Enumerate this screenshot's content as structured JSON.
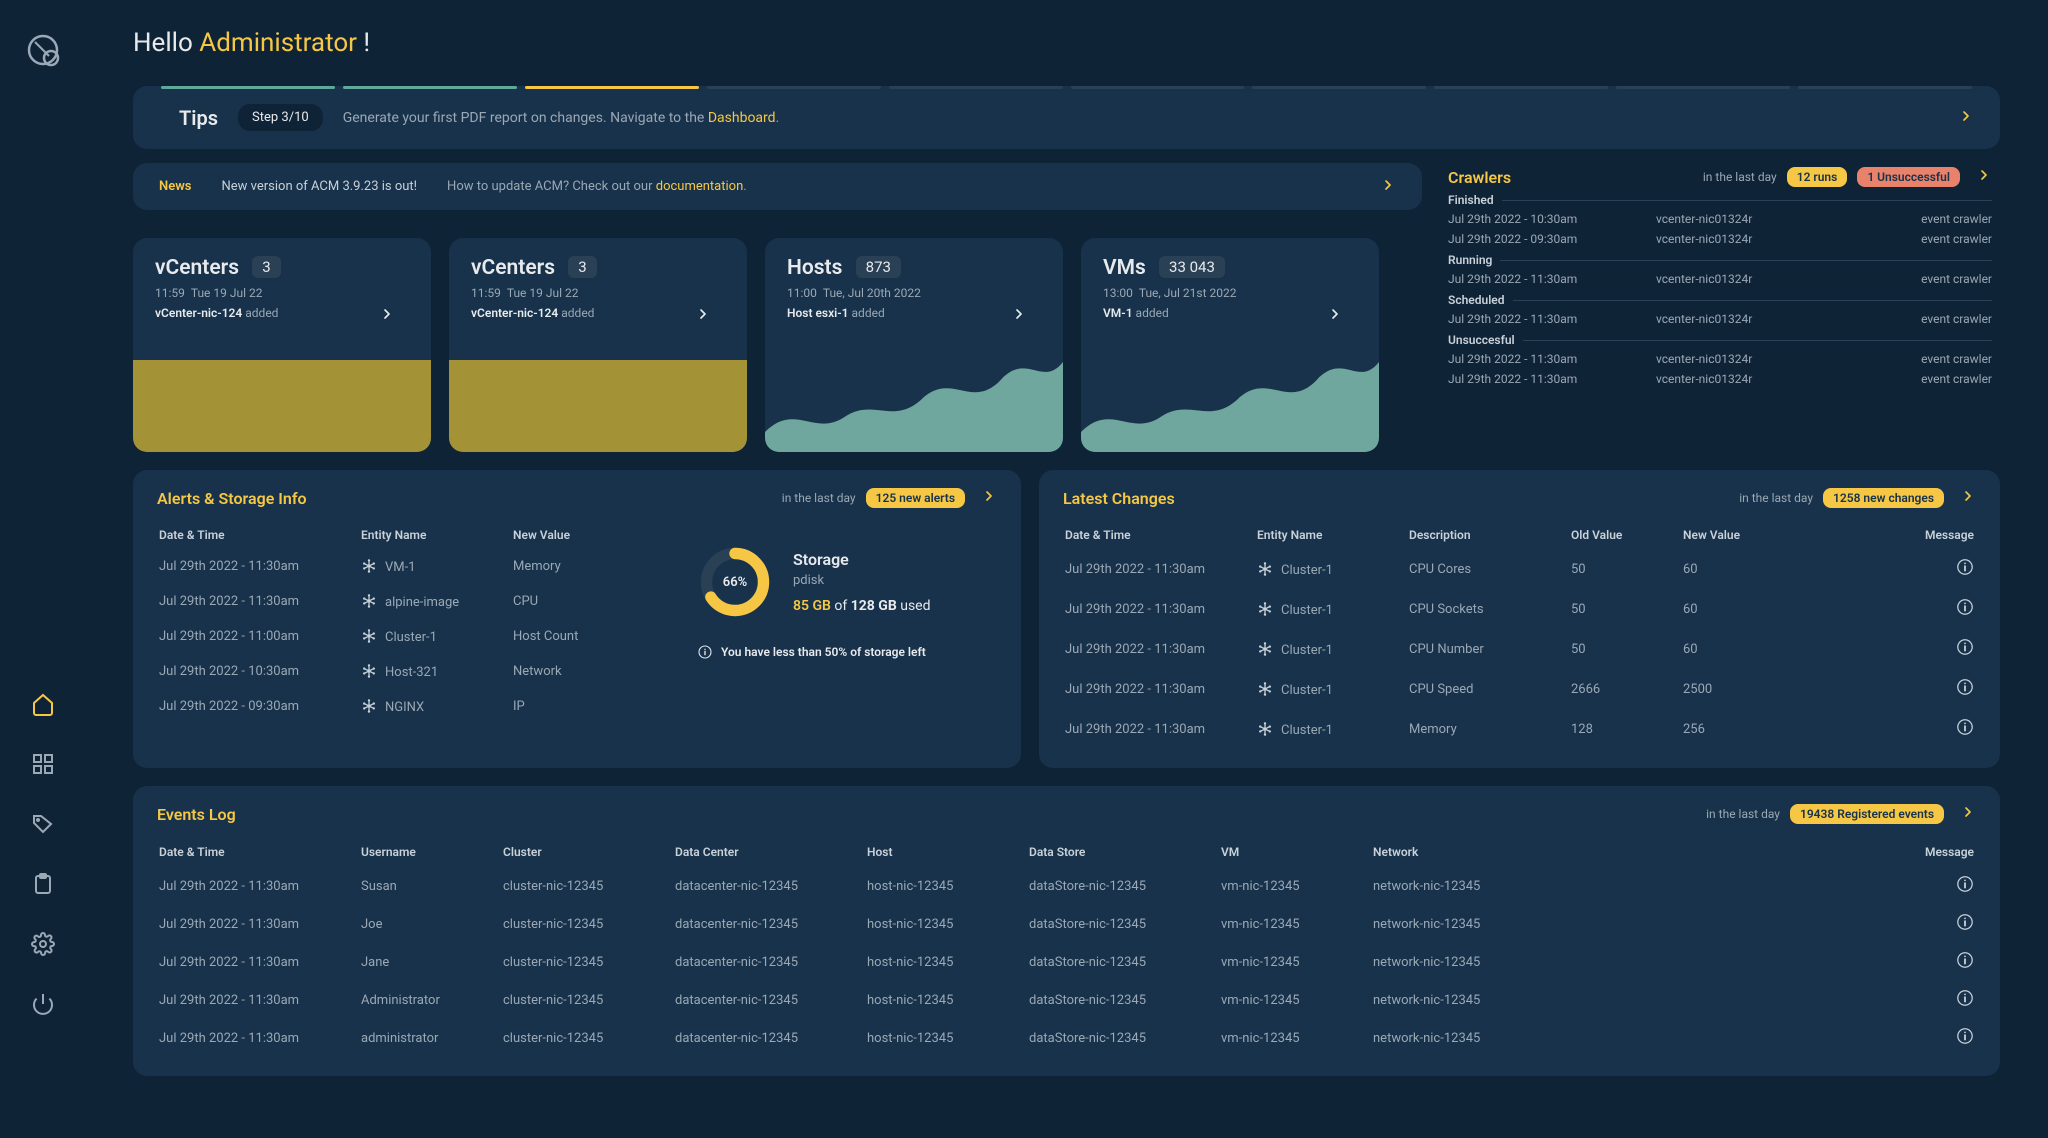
{
  "greeting": {
    "prefix": "Hello ",
    "name": "Administrator",
    "suffix": " !"
  },
  "tips": {
    "title": "Tips",
    "step_badge": "Step 3/10",
    "message_pre": "Generate your first PDF report on changes. Navigate to the ",
    "link": "Dashboard",
    "message_post": "."
  },
  "news": {
    "label": "News",
    "text": "New version of ACM 3.9.23 is out!",
    "sub_pre": "How to update ACM? Check out our ",
    "link": "documentation",
    "sub_post": "."
  },
  "crawlers": {
    "title": "Crawlers",
    "period": "in the last day",
    "runs_badge": "12 runs",
    "unsuccessful_badge": "1 Unsuccessful",
    "sections": [
      {
        "title": "Finished",
        "rows": [
          {
            "time": "Jul 29th 2022 - 10:30am",
            "target": "vcenter-nic01324r",
            "crawler": "event crawler"
          },
          {
            "time": "Jul 29th 2022 - 09:30am",
            "target": "vcenter-nic01324r",
            "crawler": "event crawler"
          }
        ]
      },
      {
        "title": "Running",
        "rows": [
          {
            "time": "Jul 29th 2022 - 11:30am",
            "target": "vcenter-nic01324r",
            "crawler": "event crawler"
          }
        ]
      },
      {
        "title": "Scheduled",
        "rows": [
          {
            "time": "Jul 29th 2022 - 11:30am",
            "target": "vcenter-nic01324r",
            "crawler": "event crawler"
          }
        ]
      },
      {
        "title": "Unsuccesful",
        "rows": [
          {
            "time": "Jul 29th 2022 - 11:30am",
            "target": "vcenter-nic01324r",
            "crawler": "event crawler"
          },
          {
            "time": "Jul 29th 2022 - 11:30am",
            "target": "vcenter-nic01324r",
            "crawler": "event crawler"
          }
        ]
      }
    ]
  },
  "stat_cards": [
    {
      "title": "vCenters",
      "count": "3",
      "time": "11:59",
      "date": "Tue 19 Jul 22",
      "entity": "vCenter-nic-124",
      "action": " added",
      "style": "yellow"
    },
    {
      "title": "vCenters",
      "count": "3",
      "time": "11:59",
      "date": "Tue 19 Jul 22",
      "entity": "vCenter-nic-124",
      "action": " added",
      "style": "yellow"
    },
    {
      "title": "Hosts",
      "count": "873",
      "time": "11:00",
      "date": "Tue, Jul 20th 2022",
      "entity": "Host esxi-1",
      "action": " added",
      "style": "area"
    },
    {
      "title": "VMs",
      "count": "33 043",
      "time": "13:00",
      "date": "Tue, Jul 21st 2022",
      "entity": "VM-1",
      "action": " added",
      "style": "area"
    }
  ],
  "alerts": {
    "title": "Alerts & Storage Info",
    "period": "in the last day",
    "badge": "125 new alerts",
    "headers": {
      "dt": "Date & Time",
      "entity": "Entity Name",
      "value": "New Value"
    },
    "rows": [
      {
        "dt": "Jul 29th 2022 - 11:30am",
        "entity": "VM-1",
        "value": "Memory"
      },
      {
        "dt": "Jul 29th 2022 - 11:30am",
        "entity": "alpine-image",
        "value": "CPU"
      },
      {
        "dt": "Jul 29th 2022 - 11:00am",
        "entity": "Cluster-1",
        "value": "Host Count"
      },
      {
        "dt": "Jul 29th 2022 - 10:30am",
        "entity": "Host-321",
        "value": "Network"
      },
      {
        "dt": "Jul 29th 2022 - 09:30am",
        "entity": "NGINX",
        "value": "IP"
      }
    ],
    "storage": {
      "title": "Storage",
      "subtitle": "pdisk",
      "percent": "66%",
      "percent_num": 66,
      "used": "85 GB",
      "of": " of ",
      "total": "128 GB",
      "suffix": " used",
      "warn": "You have less than 50% of storage left"
    }
  },
  "changes": {
    "title": "Latest Changes",
    "period": "in the last day",
    "badge": "1258 new changes",
    "headers": {
      "dt": "Date & Time",
      "entity": "Entity Name",
      "desc": "Description",
      "old": "Old Value",
      "new": "New Value",
      "msg": "Message"
    },
    "rows": [
      {
        "dt": "Jul 29th 2022 - 11:30am",
        "entity": "Cluster-1",
        "desc": "CPU Cores",
        "old": "50",
        "new": "60"
      },
      {
        "dt": "Jul 29th 2022 - 11:30am",
        "entity": "Cluster-1",
        "desc": "CPU Sockets",
        "old": "50",
        "new": "60"
      },
      {
        "dt": "Jul 29th 2022 - 11:30am",
        "entity": "Cluster-1",
        "desc": "CPU Number",
        "old": "50",
        "new": "60"
      },
      {
        "dt": "Jul 29th 2022 - 11:30am",
        "entity": "Cluster-1",
        "desc": "CPU Speed",
        "old": "2666",
        "new": "2500"
      },
      {
        "dt": "Jul 29th 2022 - 11:30am",
        "entity": "Cluster-1",
        "desc": "Memory",
        "old": "128",
        "new": "256"
      }
    ]
  },
  "events": {
    "title": "Events Log",
    "period": "in the last day",
    "badge": "19438 Registered events",
    "headers": {
      "dt": "Date & Time",
      "user": "Username",
      "cluster": "Cluster",
      "dc": "Data Center",
      "host": "Host",
      "ds": "Data Store",
      "vm": "VM",
      "net": "Network",
      "msg": "Message"
    },
    "rows": [
      {
        "dt": "Jul 29th 2022 - 11:30am",
        "user": "Susan",
        "cluster": "cluster-nic-12345",
        "dc": "datacenter-nic-12345",
        "host": "host-nic-12345",
        "ds": "dataStore-nic-12345",
        "vm": "vm-nic-12345",
        "net": "network-nic-12345"
      },
      {
        "dt": "Jul 29th 2022 - 11:30am",
        "user": "Joe",
        "cluster": "cluster-nic-12345",
        "dc": "datacenter-nic-12345",
        "host": "host-nic-12345",
        "ds": "dataStore-nic-12345",
        "vm": "vm-nic-12345",
        "net": "network-nic-12345"
      },
      {
        "dt": "Jul 29th 2022 - 11:30am",
        "user": "Jane",
        "cluster": "cluster-nic-12345",
        "dc": "datacenter-nic-12345",
        "host": "host-nic-12345",
        "ds": "dataStore-nic-12345",
        "vm": "vm-nic-12345",
        "net": "network-nic-12345"
      },
      {
        "dt": "Jul 29th 2022 - 11:30am",
        "user": "Administrator",
        "cluster": "cluster-nic-12345",
        "dc": "datacenter-nic-12345",
        "host": "host-nic-12345",
        "ds": "dataStore-nic-12345",
        "vm": "vm-nic-12345",
        "net": "network-nic-12345"
      },
      {
        "dt": "Jul 29th 2022 - 11:30am",
        "user": "administrator",
        "cluster": "cluster-nic-12345",
        "dc": "datacenter-nic-12345",
        "host": "host-nic-12345",
        "ds": "dataStore-nic-12345",
        "vm": "vm-nic-12345",
        "net": "network-nic-12345"
      }
    ]
  }
}
